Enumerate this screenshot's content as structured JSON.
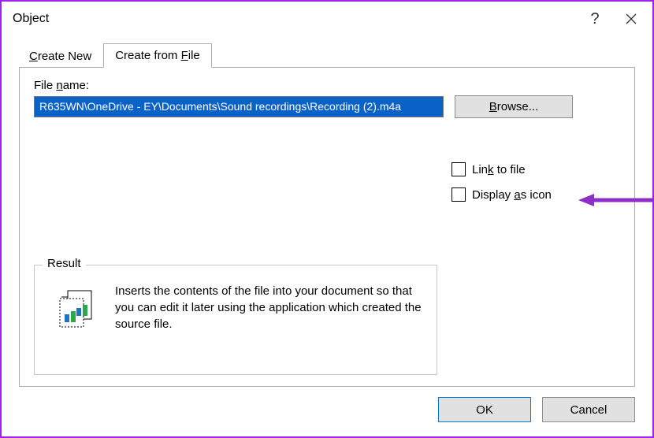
{
  "window": {
    "title": "Object"
  },
  "tabs": {
    "create_new_pre": "",
    "create_new_u": "C",
    "create_new_post": "reate New",
    "create_from_file_pre": "Create from ",
    "create_from_file_u": "F",
    "create_from_file_post": "ile"
  },
  "file": {
    "label_pre": "File ",
    "label_u": "n",
    "label_post": "ame:",
    "path": "R635WN\\OneDrive - EY\\Documents\\Sound recordings\\Recording (2).m4a"
  },
  "browse": {
    "u": "B",
    "post": "rowse..."
  },
  "checks": {
    "link_pre": "Lin",
    "link_u": "k",
    "link_post": " to file",
    "display_pre": "Display ",
    "display_u": "a",
    "display_post": "s icon"
  },
  "result": {
    "legend": "Result",
    "text": "Inserts the contents of the file into your document so that you can edit it later using the application which created the source file."
  },
  "buttons": {
    "ok": "OK",
    "cancel": "Cancel"
  }
}
